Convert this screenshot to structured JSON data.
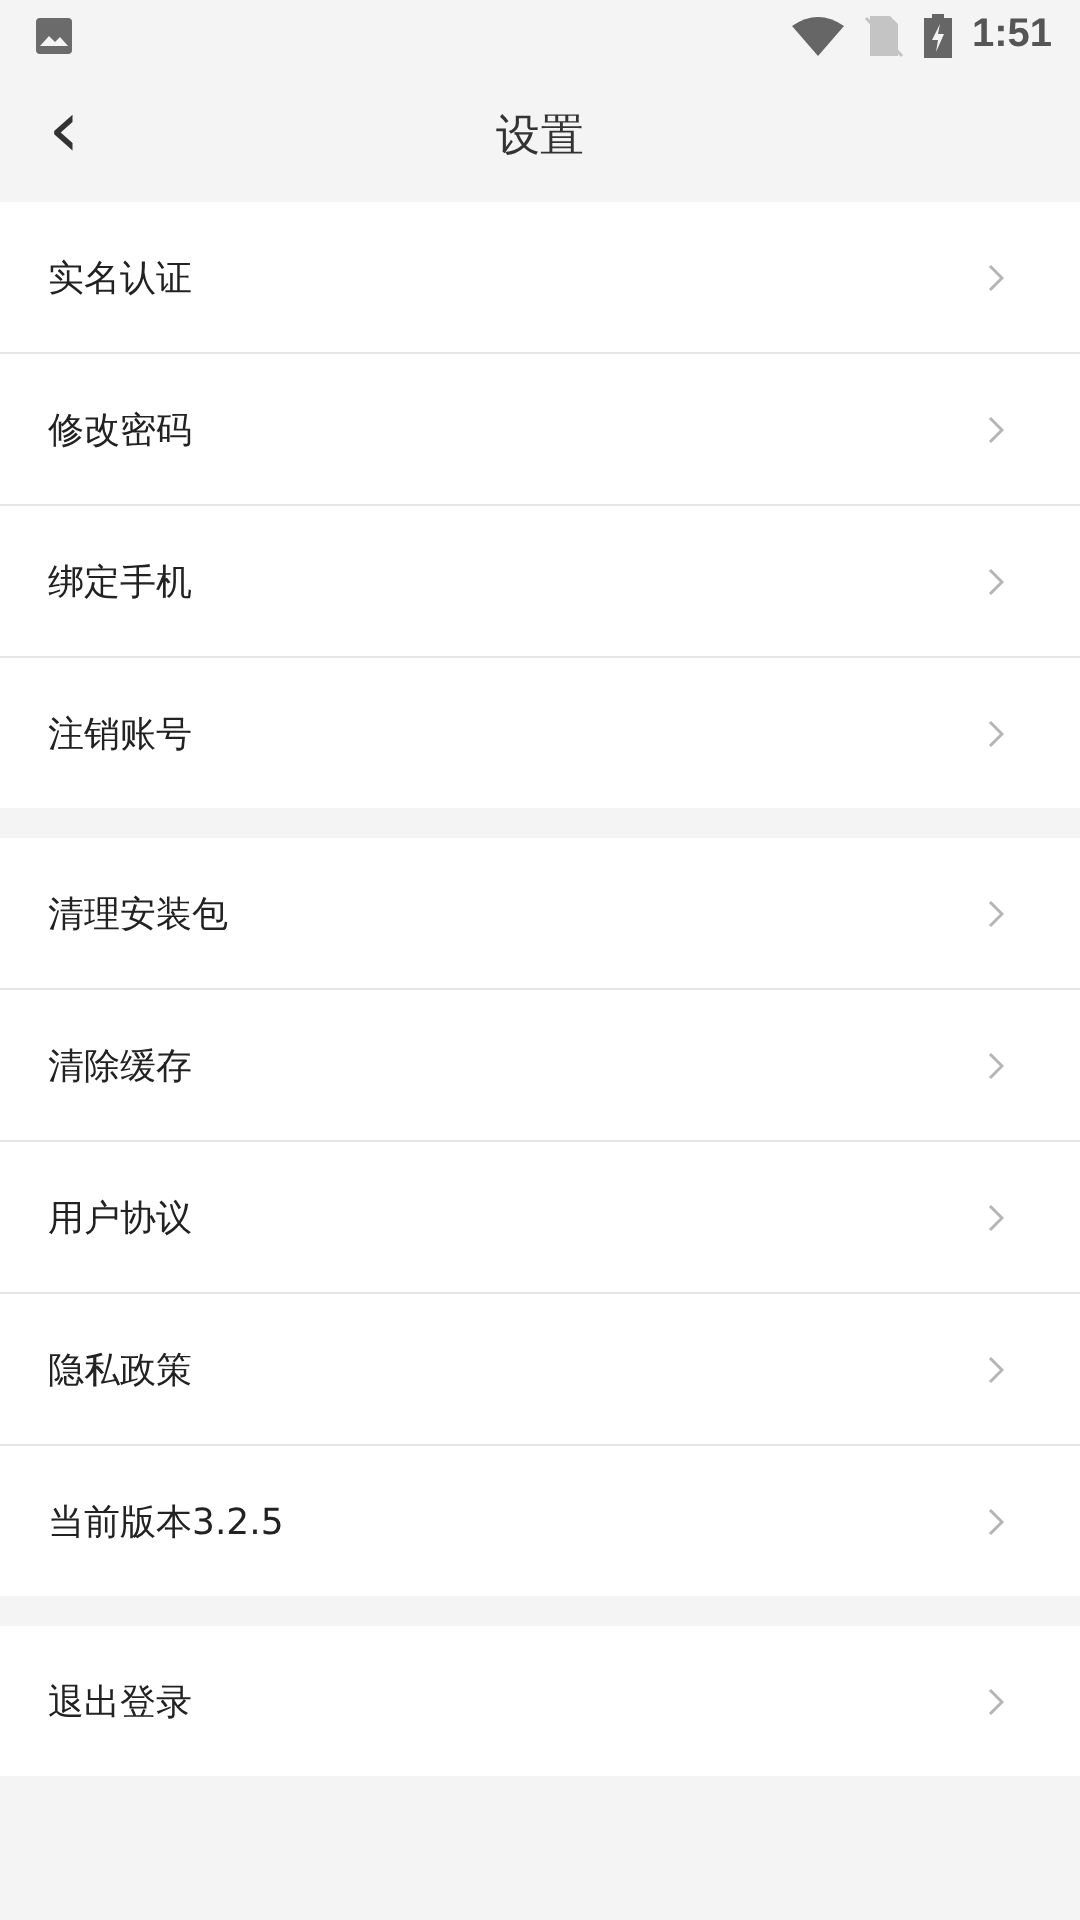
{
  "status_bar": {
    "time": "1:51"
  },
  "header": {
    "back": "‹",
    "title": "设置"
  },
  "groups": [
    {
      "items": [
        {
          "label": "实名认证"
        },
        {
          "label": "修改密码"
        },
        {
          "label": "绑定手机"
        },
        {
          "label": "注销账号"
        }
      ]
    },
    {
      "items": [
        {
          "label": "清理安装包"
        },
        {
          "label": "清除缓存"
        },
        {
          "label": "用户协议"
        },
        {
          "label": "隐私政策"
        },
        {
          "label": "当前版本3.2.5"
        }
      ]
    },
    {
      "items": [
        {
          "label": "退出登录"
        }
      ]
    }
  ]
}
